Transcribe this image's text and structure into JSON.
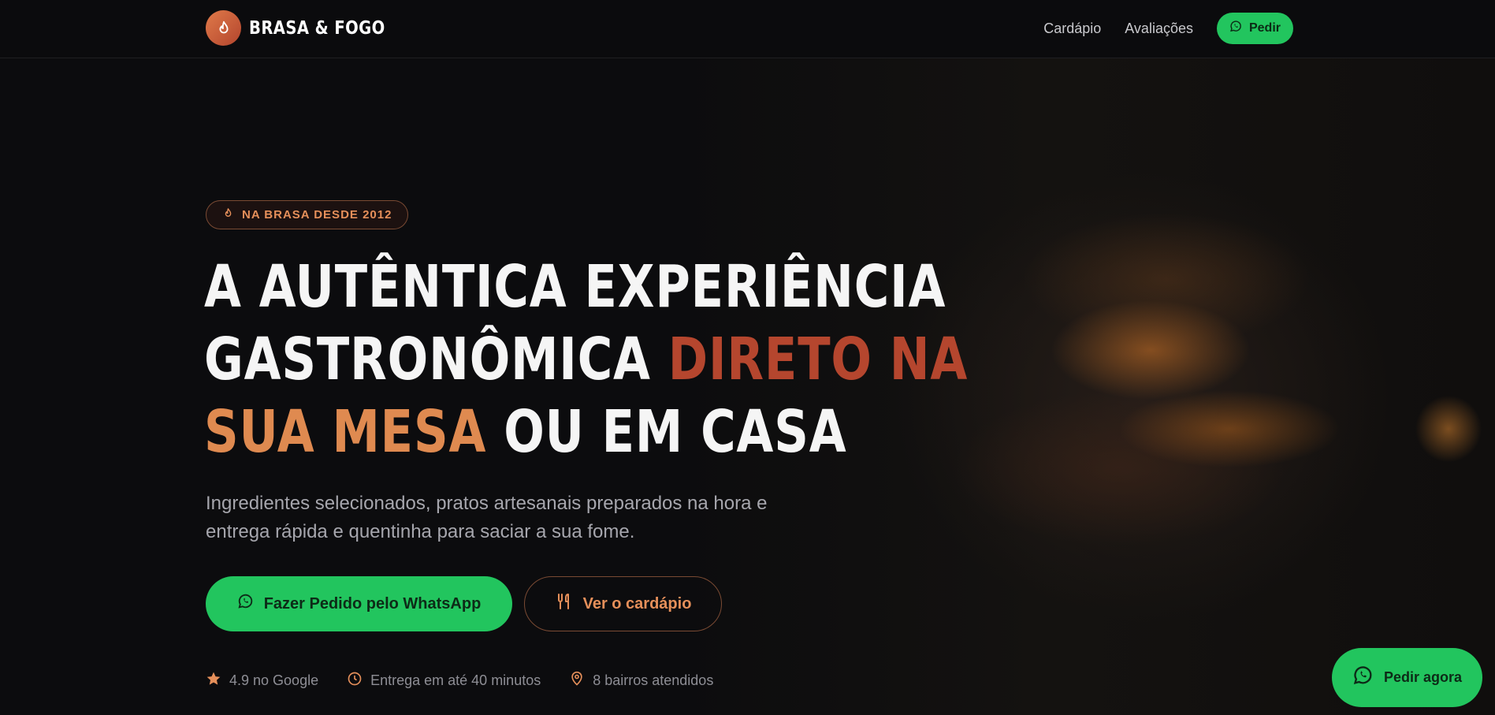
{
  "brand": {
    "name": "BRASA & FOGO"
  },
  "nav": {
    "items": [
      {
        "label": "Cardápio"
      },
      {
        "label": "Avaliações"
      }
    ],
    "order_label": "Pedir"
  },
  "hero": {
    "badge": "NA BRASA DESDE 2012",
    "headline": {
      "part1": "A AUTÊNTICA EXPERIÊNCIA",
      "part2": "GASTRONÔMICA ",
      "part3": "DIRETO NA",
      "part4": "SUA MESA",
      "part5": " OU EM CASA"
    },
    "subtitle_line1": "Ingredientes selecionados, pratos artesanais preparados na hora e",
    "subtitle_line2": "entrega rápida e quentinha para saciar a sua fome.",
    "primary_cta": "Fazer Pedido pelo WhatsApp",
    "secondary_cta": "Ver o cardápio",
    "stats": [
      {
        "icon": "star-icon",
        "text": "4.9 no Google"
      },
      {
        "icon": "clock-icon",
        "text": "Entrega em até 40 minutos"
      },
      {
        "icon": "map-pin-icon",
        "text": "8 bairros atendidos"
      }
    ]
  },
  "floating": {
    "label": "Pedir agora"
  },
  "colors": {
    "accent_green": "#22c55e",
    "accent_orange": "#df8a50",
    "accent_red": "#b5462e",
    "background": "#0c0c0e"
  }
}
